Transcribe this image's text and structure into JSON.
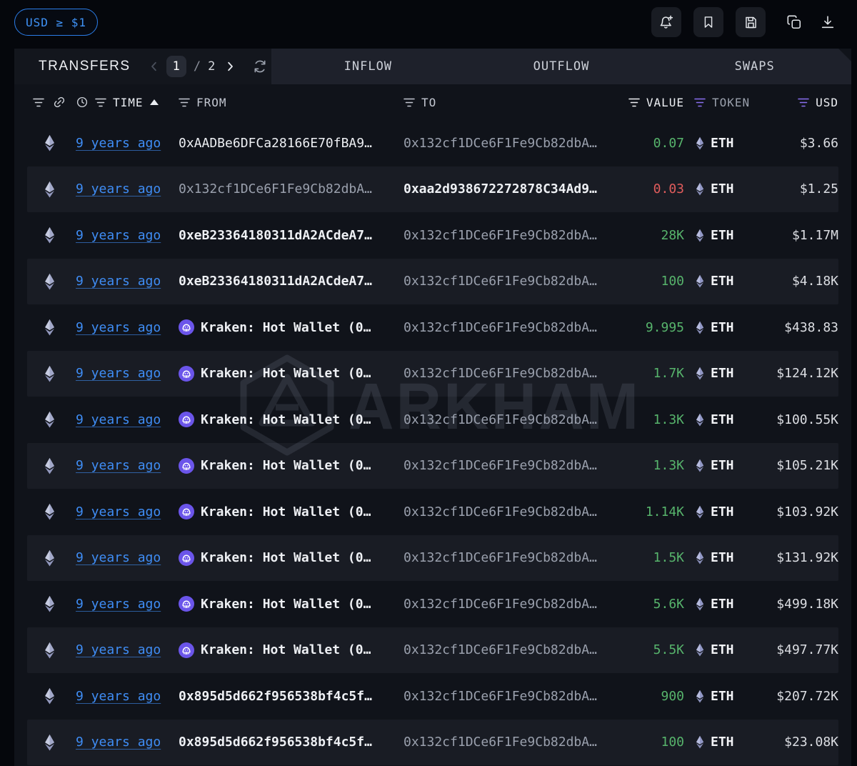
{
  "toolbar": {
    "filter_pill": "USD ≥ $1",
    "icons": [
      "alert-add",
      "bookmark",
      "save",
      "copy",
      "download"
    ]
  },
  "tabs_bar": {
    "title": "TRANSFERS",
    "page_current": "1",
    "page_separator": "/",
    "page_total": "2",
    "tabs": [
      "INFLOW",
      "OUTFLOW",
      "SWAPS"
    ]
  },
  "table": {
    "headers": {
      "time": "TIME",
      "from": "FROM",
      "to": "TO",
      "value": "VALUE",
      "token": "TOKEN",
      "usd": "USD"
    },
    "rows": [
      {
        "time": "9 years ago",
        "from": "0xAADBe6DFCa28166E70fBA9…",
        "from_kind": "address",
        "from_tone": "bright",
        "from_bold": false,
        "to": "0x132cf1DCe6F1Fe9Cb82dbA…",
        "to_tone": "dim",
        "to_bold": false,
        "value": "0.07",
        "value_tone": "green",
        "token": "ETH",
        "usd": "$3.66"
      },
      {
        "time": "9 years ago",
        "from": "0x132cf1DCe6F1Fe9Cb82dbA…",
        "from_kind": "address",
        "from_tone": "dim",
        "from_bold": false,
        "to": "0xaa2d938672272878C34Ad9…",
        "to_tone": "bright",
        "to_bold": true,
        "value": "0.03",
        "value_tone": "red",
        "token": "ETH",
        "usd": "$1.25"
      },
      {
        "time": "9 years ago",
        "from": "0xeB23364180311dA2ACdeA7…",
        "from_kind": "address",
        "from_tone": "bright",
        "from_bold": true,
        "to": "0x132cf1DCe6F1Fe9Cb82dbA…",
        "to_tone": "dim",
        "to_bold": false,
        "value": "28K",
        "value_tone": "green",
        "token": "ETH",
        "usd": "$1.17M"
      },
      {
        "time": "9 years ago",
        "from": "0xeB23364180311dA2ACdeA7…",
        "from_kind": "address",
        "from_tone": "bright",
        "from_bold": true,
        "to": "0x132cf1DCe6F1Fe9Cb82dbA…",
        "to_tone": "dim",
        "to_bold": false,
        "value": "100",
        "value_tone": "green",
        "token": "ETH",
        "usd": "$4.18K"
      },
      {
        "time": "9 years ago",
        "from": "Kraken: Hot Wallet (0…",
        "from_kind": "entity",
        "from_tone": "bright",
        "from_bold": true,
        "to": "0x132cf1DCe6F1Fe9Cb82dbA…",
        "to_tone": "dim",
        "to_bold": false,
        "value": "9.995",
        "value_tone": "green",
        "token": "ETH",
        "usd": "$438.83"
      },
      {
        "time": "9 years ago",
        "from": "Kraken: Hot Wallet (0…",
        "from_kind": "entity",
        "from_tone": "bright",
        "from_bold": true,
        "to": "0x132cf1DCe6F1Fe9Cb82dbA…",
        "to_tone": "dim",
        "to_bold": false,
        "value": "1.7K",
        "value_tone": "green",
        "token": "ETH",
        "usd": "$124.12K"
      },
      {
        "time": "9 years ago",
        "from": "Kraken: Hot Wallet (0…",
        "from_kind": "entity",
        "from_tone": "bright",
        "from_bold": true,
        "to": "0x132cf1DCe6F1Fe9Cb82dbA…",
        "to_tone": "dim",
        "to_bold": false,
        "value": "1.3K",
        "value_tone": "green",
        "token": "ETH",
        "usd": "$100.55K"
      },
      {
        "time": "9 years ago",
        "from": "Kraken: Hot Wallet (0…",
        "from_kind": "entity",
        "from_tone": "bright",
        "from_bold": true,
        "to": "0x132cf1DCe6F1Fe9Cb82dbA…",
        "to_tone": "dim",
        "to_bold": false,
        "value": "1.3K",
        "value_tone": "green",
        "token": "ETH",
        "usd": "$105.21K"
      },
      {
        "time": "9 years ago",
        "from": "Kraken: Hot Wallet (0…",
        "from_kind": "entity",
        "from_tone": "bright",
        "from_bold": true,
        "to": "0x132cf1DCe6F1Fe9Cb82dbA…",
        "to_tone": "dim",
        "to_bold": false,
        "value": "1.14K",
        "value_tone": "green",
        "token": "ETH",
        "usd": "$103.92K"
      },
      {
        "time": "9 years ago",
        "from": "Kraken: Hot Wallet (0…",
        "from_kind": "entity",
        "from_tone": "bright",
        "from_bold": true,
        "to": "0x132cf1DCe6F1Fe9Cb82dbA…",
        "to_tone": "dim",
        "to_bold": false,
        "value": "1.5K",
        "value_tone": "green",
        "token": "ETH",
        "usd": "$131.92K"
      },
      {
        "time": "9 years ago",
        "from": "Kraken: Hot Wallet (0…",
        "from_kind": "entity",
        "from_tone": "bright",
        "from_bold": true,
        "to": "0x132cf1DCe6F1Fe9Cb82dbA…",
        "to_tone": "dim",
        "to_bold": false,
        "value": "5.6K",
        "value_tone": "green",
        "token": "ETH",
        "usd": "$499.18K"
      },
      {
        "time": "9 years ago",
        "from": "Kraken: Hot Wallet (0…",
        "from_kind": "entity",
        "from_tone": "bright",
        "from_bold": true,
        "to": "0x132cf1DCe6F1Fe9Cb82dbA…",
        "to_tone": "dim",
        "to_bold": false,
        "value": "5.5K",
        "value_tone": "green",
        "token": "ETH",
        "usd": "$497.77K"
      },
      {
        "time": "9 years ago",
        "from": "0x895d5d662f956538bf4c5f…",
        "from_kind": "address",
        "from_tone": "bright",
        "from_bold": true,
        "to": "0x132cf1DCe6F1Fe9Cb82dbA…",
        "to_tone": "dim",
        "to_bold": false,
        "value": "900",
        "value_tone": "green",
        "token": "ETH",
        "usd": "$207.72K"
      },
      {
        "time": "9 years ago",
        "from": "0x895d5d662f956538bf4c5f…",
        "from_kind": "address",
        "from_tone": "bright",
        "from_bold": true,
        "to": "0x132cf1DCe6F1Fe9Cb82dbA…",
        "to_tone": "dim",
        "to_bold": false,
        "value": "100",
        "value_tone": "green",
        "token": "ETH",
        "usd": "$23.08K"
      }
    ]
  },
  "watermark": {
    "text": "ARKHAM"
  },
  "colors": {
    "accent_blue": "#3f93f8",
    "green": "#57b46c",
    "red": "#e05c5c",
    "purple_filter": "#8a6ff0",
    "kraken_purple": "#6b55ea",
    "stripe": "#191c24",
    "panel": "#10131a"
  }
}
